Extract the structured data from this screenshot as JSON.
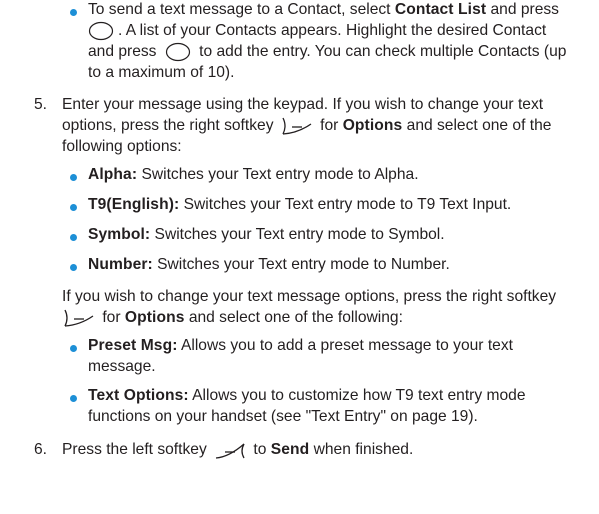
{
  "items": [
    {
      "type": "bullet",
      "lines": [
        {
          "t1": "To send a text message to a Contact, select ",
          "b1": "Contact List",
          "t2": " and press"
        },
        {
          "t1": ". A list of your Contacts appears. Highlight the desired Contact"
        },
        {
          "t1": "and press ",
          "t2": " to add the entry. You can check multiple Contacts (up"
        },
        {
          "t1": "to a maximum of 10)."
        }
      ]
    },
    {
      "type": "step",
      "number": "5.",
      "lines": [
        {
          "t1": "Enter your message using the keypad. If you wish to change your text"
        },
        {
          "t1": "options, press the right softkey ",
          "t2": " for ",
          "b1": "Options",
          "t3": " and select one of the"
        },
        {
          "t1": "following options:"
        }
      ]
    },
    {
      "type": "option",
      "label": "Alpha:",
      "text": " Switches your Text entry mode to Alpha."
    },
    {
      "type": "option",
      "label": "T9(English):",
      "text": " Switches your Text entry mode to T9 Text Input."
    },
    {
      "type": "option",
      "label": "Symbol:",
      "text": " Switches your Text entry mode to Symbol."
    },
    {
      "type": "option",
      "label": "Number:",
      "text": " Switches your Text entry mode to Number."
    },
    {
      "type": "para",
      "lines": [
        {
          "t1": "If you wish to change your text message options, press the right softkey"
        },
        {
          "t2": " for ",
          "b1": "Options",
          "t3": " and select one of the following:"
        }
      ]
    },
    {
      "type": "option2",
      "label": "Preset Msg:",
      "lines": [
        " Allows you to add a preset message to your text",
        "message."
      ]
    },
    {
      "type": "option2",
      "label": "Text Options:",
      "lines": [
        " Allows you to customize how T9 text entry mode",
        "functions on your handset (see \"Text Entry\" on page 19)."
      ]
    },
    {
      "type": "step",
      "number": "6.",
      "lines": [
        {
          "t1": "Press the left softkey ",
          "t2": " to ",
          "b1": "Send",
          "t3": " when finished."
        }
      ]
    }
  ],
  "icons": {
    "ok_key": "circle-ok-key-icon",
    "right_softkey": "right-softkey-icon",
    "left_softkey": "left-softkey-icon"
  },
  "colors": {
    "text": "#231f20",
    "bullet": "#1d8fd6"
  }
}
